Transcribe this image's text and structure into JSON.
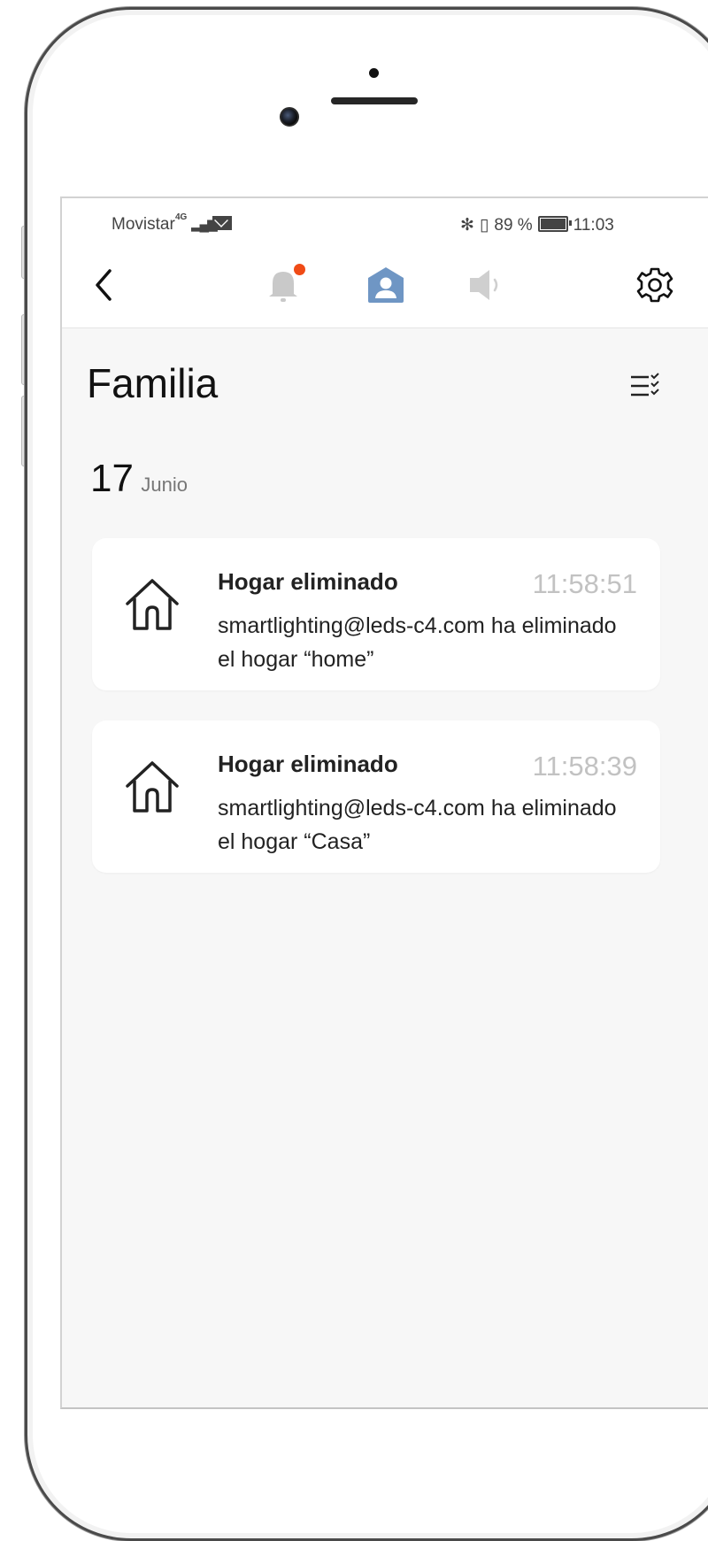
{
  "status_bar": {
    "carrier": "Movistar",
    "network": "4G",
    "battery": "89 %",
    "time": "11:03"
  },
  "nav": {
    "icons": [
      "back-icon",
      "bell-icon",
      "profile-home-icon",
      "speaker-icon",
      "gear-icon"
    ],
    "accent_color": "#6f96c4",
    "notification_dot_color": "#f04b16"
  },
  "page": {
    "title": "Familia",
    "date_day": "17",
    "date_month": "Junio"
  },
  "notifications": [
    {
      "title": "Hogar eliminado",
      "time": "11:58:51",
      "message": "smartlighting@leds-c4.com ha eliminado el hogar “home”"
    },
    {
      "title": "Hogar eliminado",
      "time": "11:58:39",
      "message": "smartlighting@leds-c4.com ha eliminado el hogar “Casa”"
    }
  ]
}
